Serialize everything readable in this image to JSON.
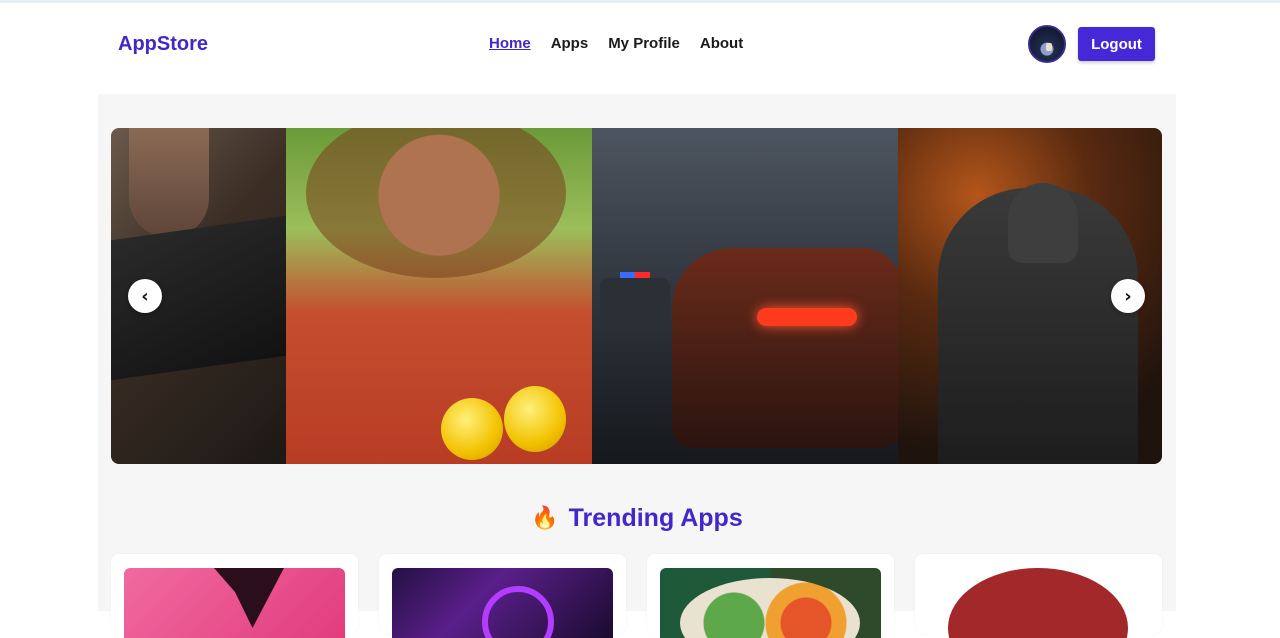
{
  "header": {
    "brand": "AppStore",
    "nav": [
      "Home",
      "Apps",
      "My Profile",
      "About"
    ],
    "active_nav": "Home",
    "logout_label": "Logout"
  },
  "carousel": {
    "prev_label": "‹",
    "next_label": "›"
  },
  "trending": {
    "icon": "fire-icon",
    "title": "Trending Apps"
  },
  "colors": {
    "brand": "#4527c9",
    "button": "#4628d8",
    "section_bg": "#f6f6f6"
  }
}
